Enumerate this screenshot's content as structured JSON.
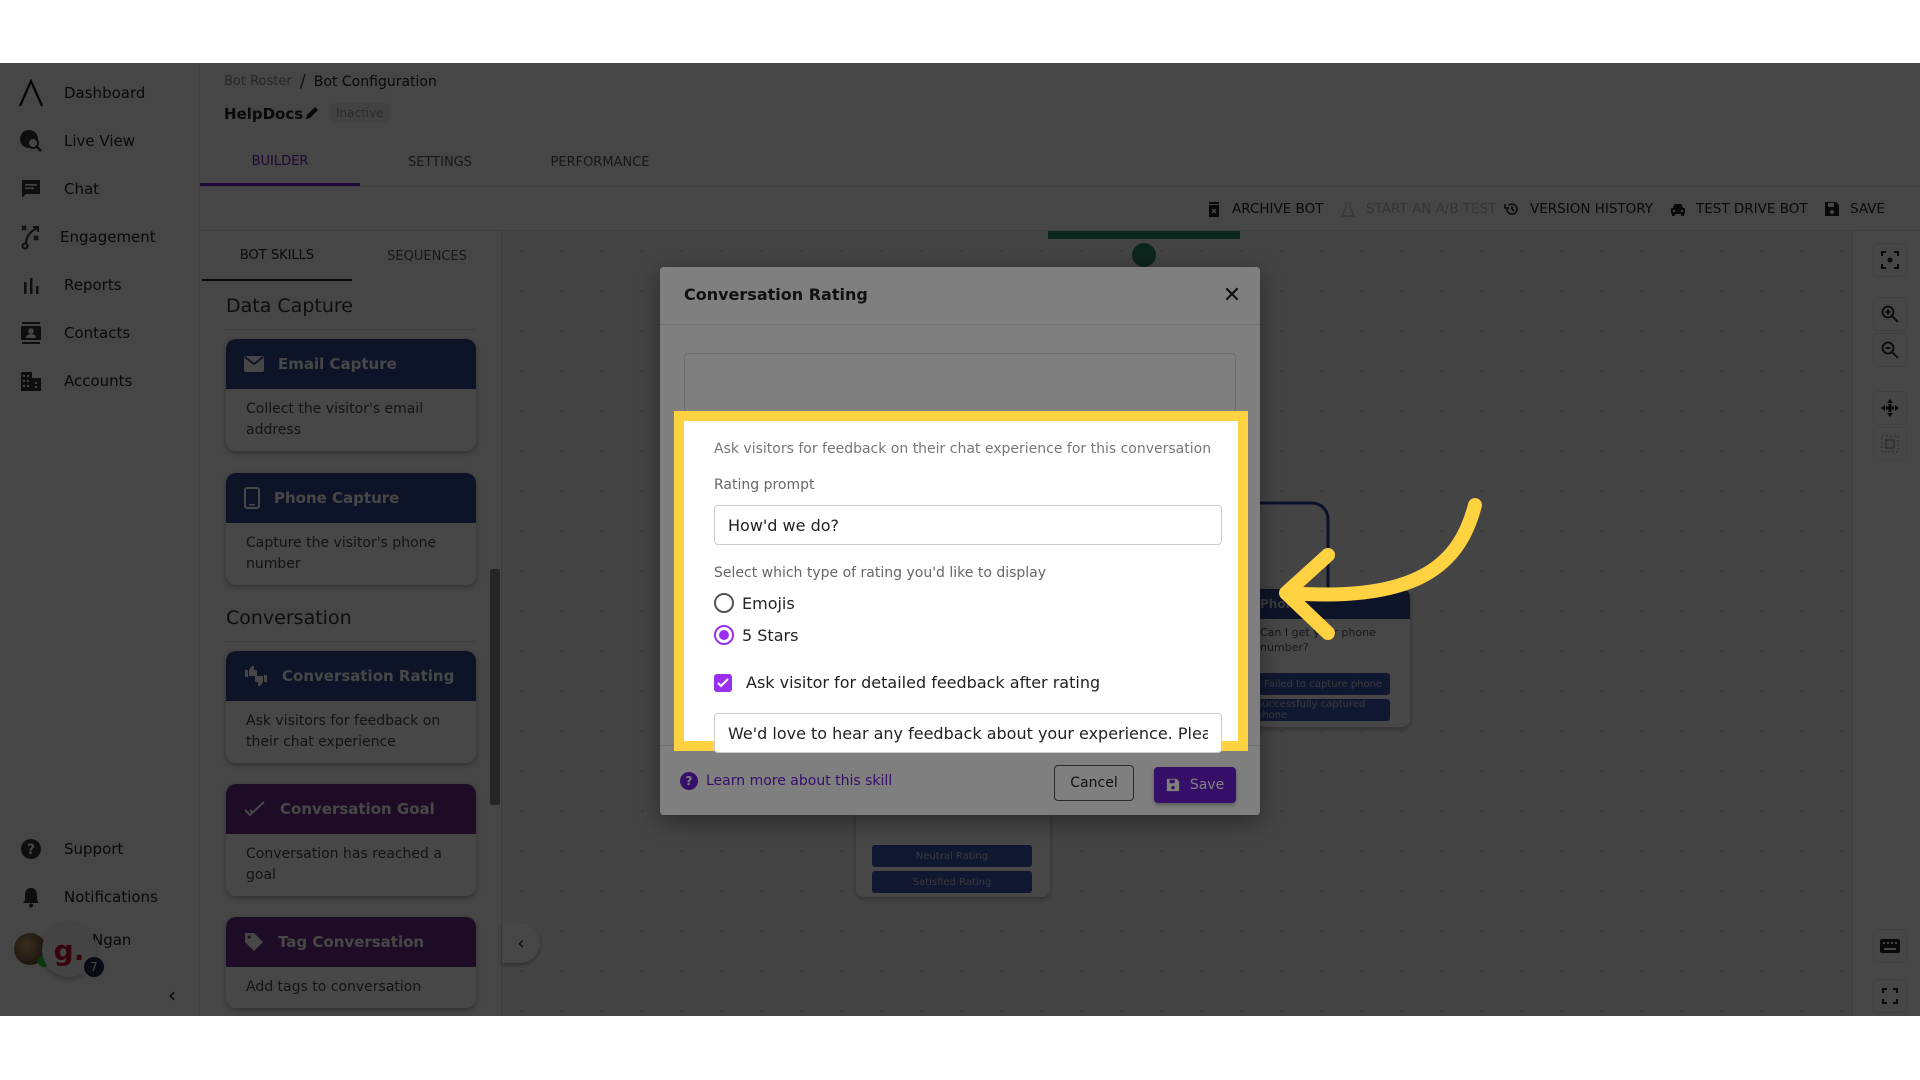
{
  "nav": {
    "items": [
      {
        "label": "Dashboard",
        "icon": "logo-icon"
      },
      {
        "label": "Live View",
        "icon": "globe-search-icon"
      },
      {
        "label": "Chat",
        "icon": "chat-icon"
      },
      {
        "label": "Engagement",
        "icon": "strategy-icon"
      },
      {
        "label": "Reports",
        "icon": "bar-chart-icon"
      },
      {
        "label": "Contacts",
        "icon": "contacts-icon"
      },
      {
        "label": "Accounts",
        "icon": "building-icon"
      }
    ],
    "bottom": [
      {
        "label": "Support",
        "icon": "help-icon"
      },
      {
        "label": "Notifications",
        "icon": "bell-icon"
      }
    ],
    "user_name": "Ngan",
    "bubble_letter": "g.",
    "bubble_badge": "7"
  },
  "header": {
    "breadcrumb": [
      "Bot Roster",
      "Bot Configuration"
    ],
    "breadcrumb_sep": "/",
    "bot_name": "HelpDocs",
    "status": "Inactive",
    "tabs": [
      "BUILDER",
      "SETTINGS",
      "PERFORMANCE"
    ],
    "active_tab": "BUILDER"
  },
  "toolbar": {
    "archive": "ARCHIVE BOT",
    "ab_test": "START AN A/B TEST",
    "version_history": "VERSION HISTORY",
    "test_drive": "TEST DRIVE BOT",
    "save": "SAVE"
  },
  "skills_panel": {
    "tabs": [
      "BOT SKILLS",
      "SEQUENCES"
    ],
    "sections": [
      {
        "title": "Data Capture",
        "cards": [
          {
            "title": "Email Capture",
            "desc": "Collect the visitor's email address",
            "color": "#35488f"
          },
          {
            "title": "Phone Capture",
            "desc": "Capture the visitor's phone number",
            "color": "#35488f"
          }
        ]
      },
      {
        "title": "Conversation",
        "cards": [
          {
            "title": "Conversation Rating",
            "desc": "Ask visitors for feedback on their chat experience",
            "color": "#35488f"
          },
          {
            "title": "Conversation Goal",
            "desc": "Conversation has reached a goal",
            "color": "#6b2c8c"
          },
          {
            "title": "Tag Conversation",
            "desc": "Add tags to conversation",
            "color": "#6b2c8c"
          }
        ]
      }
    ]
  },
  "canvas": {
    "phone_node": {
      "title": "Phone",
      "text": "Can I get your phone number?",
      "buttons": [
        "Failed to capture phone",
        "Successfully captured phone"
      ]
    },
    "rating_node": {
      "buttons": [
        "Neutral Rating",
        "Satisfied Rating"
      ]
    }
  },
  "modal": {
    "title": "Conversation Rating",
    "description": "Ask visitors for feedback on their chat experience for this conversation",
    "rating_prompt_label": "Rating prompt",
    "rating_prompt_value": "How'd we do?",
    "rating_type_label": "Select which type of rating you'd like to display",
    "rating_options": [
      "Emojis",
      "5 Stars"
    ],
    "selected_rating": "5 Stars",
    "detailed_feedback_label": "Ask visitor for detailed feedback after rating",
    "detailed_feedback_checked": true,
    "detailed_feedback_value": "We'd love to hear any feedback about your experience. Please",
    "learn_more": "Learn more about this skill",
    "cancel": "Cancel",
    "save": "Save"
  },
  "colors": {
    "accent": "#6a1fd1",
    "highlight": "#ffd241",
    "skill_blue": "#35488f",
    "skill_purple": "#6b2c8c"
  }
}
